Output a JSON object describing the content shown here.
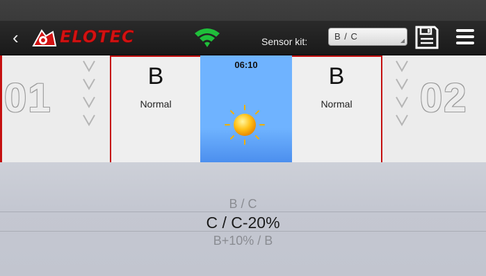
{
  "app": {
    "logo_text": "ELOTEC"
  },
  "header": {
    "sensor_kit_label": "Sensor kit:",
    "sensor_kit_value": "B / C"
  },
  "zones": [
    {
      "number": "01"
    },
    {
      "number": "02"
    }
  ],
  "detectors": [
    {
      "letter": "B",
      "mode": "Normal"
    },
    {
      "letter": "B",
      "mode": "Normal"
    }
  ],
  "sky": {
    "time": "06:10"
  },
  "picker": {
    "options": [
      "B / C",
      "C / C-20%",
      "B+10% / B"
    ],
    "selected": "C / C-20%"
  },
  "colors": {
    "brand_red": "#d21212",
    "wifi_green": "#1fbf3a",
    "sky_blue": "#6fb3ff"
  },
  "icons": [
    "back-arrow-icon",
    "elotec-logo-icon",
    "wifi-icon",
    "save-icon",
    "menu-icon",
    "chevron-down-icon",
    "sun-icon"
  ]
}
